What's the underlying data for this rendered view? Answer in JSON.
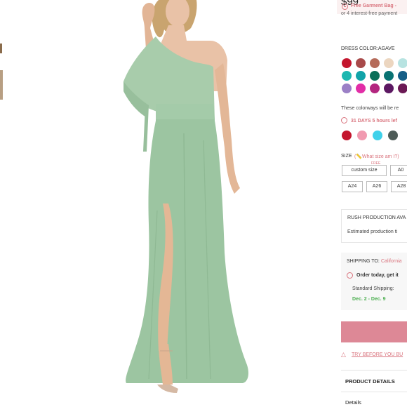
{
  "product": {
    "price": "$99",
    "installment": "or 4 interest-free payment",
    "promo": "Free Garment Bag -"
  },
  "color_section": {
    "label": "DRESS COLOR:AGAVE",
    "swatches_row1": [
      "#c4162e",
      "#a84a4a",
      "#b56b5a",
      "#ecd6c0",
      "#b7e3e1"
    ],
    "swatches_row2": [
      "#1cb7b0",
      "#11a3a8",
      "#0a6f59",
      "#0a7373",
      "#155e86"
    ],
    "swatches_row3": [
      "#9b80c6",
      "#e22ea7",
      "#b3267f",
      "#5c1862",
      "#6b1955"
    ],
    "note": "These colorways will be re",
    "days": "31 DAYS 5 hours lef",
    "swatches_row4": [
      "#c4162e",
      "#f19ab0",
      "#3fd1ea",
      "#4e5c58"
    ]
  },
  "size_section": {
    "label": "SIZE",
    "help": "(📏What size am I?)",
    "free_tag": "FREE",
    "options": [
      "custom size",
      "A0",
      "A24",
      "A26",
      "A28"
    ]
  },
  "rush": {
    "title": "RUSH PRODUCTION AVA",
    "subtitle": "Estimated production ti"
  },
  "shipping": {
    "title": "SHIPPING TO:",
    "location": "California",
    "order_text": "Order today,  get it",
    "standard": "Standard Shipping:",
    "dates": "Dec. 2 - Dec. 9"
  },
  "try_before": "TRY BEFORE YOU BU",
  "details": {
    "title": "PRODUCT DETAILS",
    "sub": "Details"
  },
  "colors": {
    "accent": "#d9737d",
    "button": "#dd8896",
    "dress": "#9cc5a1"
  }
}
